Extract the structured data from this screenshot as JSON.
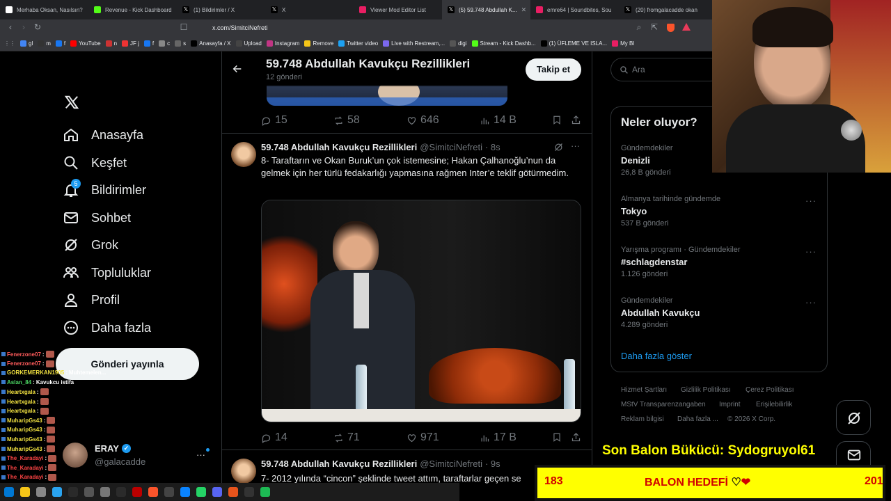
{
  "tabs": [
    {
      "title": "Merhaba Oksan, Nasılsın?",
      "icon": "threads-icon",
      "color": "#ffffff"
    },
    {
      "title": "Revenue - Kick Dashboard",
      "icon": "kick-icon",
      "color": "#53fc18"
    },
    {
      "title": "(1) Bildirimler / X",
      "icon": "x-icon",
      "color": "#ffffff"
    },
    {
      "title": "X",
      "icon": "x-icon",
      "color": "#ffffff"
    },
    {
      "title": "Viewer Mod Editor List",
      "icon": "streamelements-icon",
      "color": "#e91e63"
    },
    {
      "title": "(5) 59.748 Abdullah K...",
      "icon": "x-icon",
      "color": "#ffffff",
      "active": true
    },
    {
      "title": "emre64 | Soundbites, Sou",
      "icon": "streamelements-icon",
      "color": "#e91e63"
    },
    {
      "title": "(20) fromgalacadde okan",
      "icon": "x-icon",
      "color": "#ffffff"
    }
  ],
  "url": "x.com/SimitciNefreti",
  "bookmarks": [
    "gl",
    "m",
    "f",
    "YouTube",
    "n",
    "JF j",
    "f",
    "c",
    "s",
    "Anasayfa / X",
    "Upload",
    "Instagram",
    "Remove",
    "Twitter video",
    "Live with Restream,...",
    "digi",
    "Stream - Kick Dashb...",
    "(1) ÜFLEME VE ISLA...",
    "My Bl"
  ],
  "nav": {
    "home": "Anasayfa",
    "explore": "Keşfet",
    "notifications": "Bildirimler",
    "notif_badge": "5",
    "messages": "Sohbet",
    "grok": "Grok",
    "communities": "Topluluklar",
    "profile": "Profil",
    "more": "Daha fazla",
    "post_button": "Gönderi yayınla"
  },
  "account": {
    "name": "ERAY",
    "handle": "@galacadde"
  },
  "header": {
    "title": "59.748 Abdullah Kavukçu Rezillikleri",
    "subtitle": "12 gönderi",
    "follow": "Takip et"
  },
  "prev_tweet": {
    "replies": "15",
    "reposts": "58",
    "likes": "646",
    "views": "14 B"
  },
  "tweet": {
    "name": "59.748 Abdullah Kavukçu Rezillikleri",
    "handle": "@SimitciNefreti",
    "time": "· 8s",
    "text": "8- Taraftarın ve Okan Buruk’un çok istemesine; Hakan Çalhanoğlu’nun da gelmek için her türlü fedakarlığı yapmasına rağmen Inter’e teklif götürmedim.",
    "replies": "14",
    "reposts": "71",
    "likes": "971",
    "views": "17 B"
  },
  "next_tweet": {
    "name": "59.748 Abdullah Kavukçu Rezillikleri",
    "handle": "@SimitciNefreti",
    "time": "· 9s",
    "text": "7- 2012 yılında “cincon” şeklinde tweet attım, taraftarlar geçen se"
  },
  "search": {
    "placeholder": "Ara"
  },
  "trends": {
    "title": "Neler oluyor?",
    "items": [
      {
        "category": "Gündemdekiler",
        "name": "Denizli",
        "count": "26,8 B gönderi"
      },
      {
        "category": "Almanya tarihinde gündemde",
        "name": "Tokyo",
        "count": "537 B gönderi"
      },
      {
        "category": "Yarışma programı · Gündemdekiler",
        "name": "#schlagdenstar",
        "count": "1.126 gönderi"
      },
      {
        "category": "Gündemdekiler",
        "name": "Abdullah Kavukçu",
        "count": "4.289 gönderi"
      }
    ],
    "show_more": "Daha fazla göster"
  },
  "footer": {
    "terms": "Hizmet Şartları",
    "privacy": "Gizlilik Politikası",
    "cookies": "Çerez Politikası",
    "nstv": "MStV Transparenzangaben",
    "imprint": "Imprint",
    "accessibility": "Erişilebilirlik",
    "ads": "Reklam bilgisi",
    "more": "Daha fazla ...",
    "copyright": "© 2026 X Corp."
  },
  "overlay": {
    "banner": "Son Balon Bükücü: Sydogruyol61",
    "goal_left": "183",
    "goal_label": "BALON HEDEFİ",
    "goal_right": "201"
  },
  "chat": [
    {
      "user": "Fenerzone07",
      "color": "#ff5b5b",
      "msg": ""
    },
    {
      "user": "Fenerzone07",
      "color": "#ff5b5b",
      "msg": ""
    },
    {
      "user": "GORKEMERKAN1905",
      "color": "#f0e040",
      "msg": "Muhtemelen..."
    },
    {
      "user": "Aslan_84",
      "color": "#4cd964",
      "msg": "Kavukcu istifa"
    },
    {
      "user": "Heartxgala",
      "color": "#f0e040",
      "msg": ""
    },
    {
      "user": "Heartxgala",
      "color": "#f0e040",
      "msg": ""
    },
    {
      "user": "Heartxgala",
      "color": "#f0e040",
      "msg": ""
    },
    {
      "user": "MuharipGs43",
      "color": "#f0e040",
      "msg": ""
    },
    {
      "user": "MuharipGs43",
      "color": "#f0e040",
      "msg": ""
    },
    {
      "user": "MuharipGs43",
      "color": "#f0e040",
      "msg": ""
    },
    {
      "user": "MuharipGs43",
      "color": "#f0e040",
      "msg": ""
    },
    {
      "user": "The_Karadayi",
      "color": "#ff4444",
      "msg": ""
    },
    {
      "user": "The_Karadayi",
      "color": "#ff4444",
      "msg": ""
    },
    {
      "user": "The_Karadayi",
      "color": "#ff4444",
      "msg": ""
    }
  ],
  "colors": {
    "accent": "#1d9bf0",
    "background": "#000000",
    "banner": "#ffff00",
    "banner_text": "#d00000"
  }
}
